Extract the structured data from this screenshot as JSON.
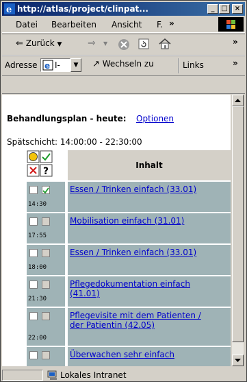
{
  "window": {
    "title": "http://atlas/project/clinpat..."
  },
  "menu": [
    "Datei",
    "Bearbeiten",
    "Ansicht",
    "F.",
    "»"
  ],
  "toolbar": {
    "back_label": "Zurück",
    "more": "»"
  },
  "address": {
    "label": "Adresse",
    "value": "I-",
    "go_label": "Wechseln zu",
    "links_label": "Links",
    "links_more": "»"
  },
  "page": {
    "heading": "Behandlungsplan - heute:",
    "options_link": "Optionen",
    "shift": "Spätschicht: 14:00:00 - 22:30:00",
    "column_header": "Inhalt",
    "rows": [
      {
        "time": "14:30",
        "checked": true,
        "text": "Essen / Trinken einfach (33.01)"
      },
      {
        "time": "17:55",
        "checked": false,
        "text": "Mobilisation einfach (31.01)"
      },
      {
        "time": "18:00",
        "checked": false,
        "text": "Essen / Trinken einfach (33.01)"
      },
      {
        "time": "21:30",
        "checked": false,
        "text": "Pflegedokumentation einfach (41.01)"
      },
      {
        "time": "22:00",
        "checked": false,
        "text": "Pflegevisite mit dem Patienten / der Patientin (42.05)"
      },
      {
        "time": "",
        "checked": false,
        "text": "Überwachen sehr einfach"
      }
    ]
  },
  "status": {
    "zone": "Lokales Intranet"
  }
}
